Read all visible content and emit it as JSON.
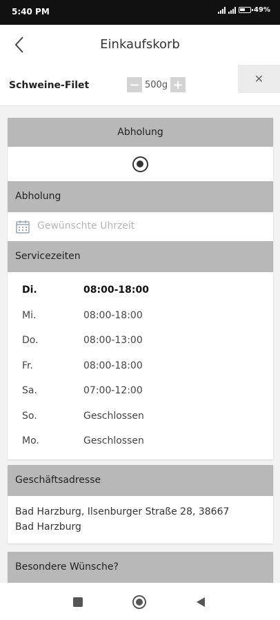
{
  "status": {
    "time": "5:40 PM",
    "battery": "49"
  },
  "appbar": {
    "title": "Einkaufskorb"
  },
  "cart": {
    "product": "Schweine-Filet",
    "quantity": "500g",
    "minus": "−",
    "plus": "+",
    "remove": "✕"
  },
  "delivery": {
    "header": "Abholung",
    "selected_option": "Abholung"
  },
  "pickup": {
    "header": "Abholung",
    "time_placeholder": "Gewünschte Uhrzeit"
  },
  "service": {
    "header": "Servicezeiten",
    "rows": [
      {
        "day": "Di.",
        "hours": "08:00-18:00"
      },
      {
        "day": "Mi.",
        "hours": "08:00-18:00"
      },
      {
        "day": "Do.",
        "hours": "08:00-13:00"
      },
      {
        "day": "Fr.",
        "hours": "08:00-18:00"
      },
      {
        "day": "Sa.",
        "hours": "07:00-12:00"
      },
      {
        "day": "So.",
        "hours": "Geschlossen"
      },
      {
        "day": "Mo.",
        "hours": "Geschlossen"
      }
    ]
  },
  "address": {
    "header": "Geschäftsadresse",
    "line1": "Bad Harzburg, Ilsenburger Straße 28, 38667",
    "line2": "Bad Harzburg"
  },
  "wishes": {
    "header": "Besondere Wünsche?"
  },
  "icons": {
    "back": "chevron-left-icon",
    "calendar": "calendar-icon",
    "remove": "close-icon",
    "nav_recent": "square-icon",
    "nav_home": "circle-icon",
    "nav_back": "triangle-back-icon"
  }
}
